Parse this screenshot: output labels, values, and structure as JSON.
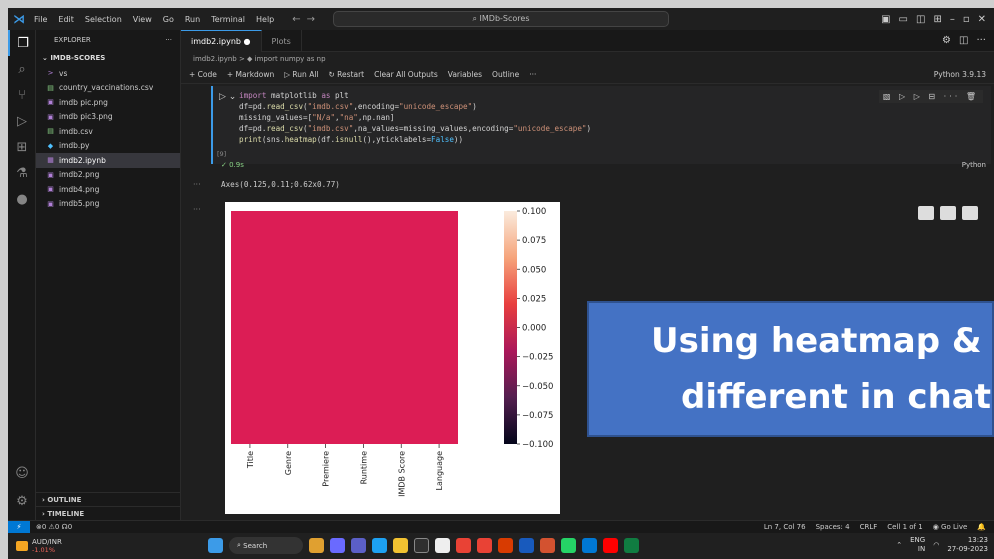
{
  "titlebar": {
    "menus": [
      "File",
      "Edit",
      "Selection",
      "View",
      "Go",
      "Run",
      "Terminal",
      "Help"
    ],
    "search": "IMDb-Scores"
  },
  "sidebar": {
    "header": "EXPLORER",
    "folder": "IMDB-SCORES",
    "items": [
      {
        "label": "vs",
        "icon": ">"
      },
      {
        "label": "country_vaccinations.csv",
        "icon": "▤"
      },
      {
        "label": "imdb pic.png",
        "icon": "▣"
      },
      {
        "label": "imdb pic3.png",
        "icon": "▣"
      },
      {
        "label": "imdb.csv",
        "icon": "▤"
      },
      {
        "label": "imdb.py",
        "icon": "◆"
      },
      {
        "label": "imdb2.ipynb",
        "icon": "▦"
      },
      {
        "label": "imdb2.png",
        "icon": "▣"
      },
      {
        "label": "imdb4.png",
        "icon": "▣"
      },
      {
        "label": "imdb5.png",
        "icon": "▣"
      }
    ],
    "outline": "OUTLINE",
    "timeline": "TIMELINE"
  },
  "tabs": [
    {
      "label": "imdb2.ipynb ●"
    },
    {
      "label": "Plots"
    }
  ],
  "breadcrumb": "imdb2.ipynb > ◆ import numpy as np",
  "toolbar": {
    "code": "+ Code",
    "markdown": "+ Markdown",
    "run_all": "▷ Run All",
    "restart": "↻ Restart",
    "clear": "Clear All Outputs",
    "variables": "Variables",
    "outline": "Outline",
    "more": "···",
    "kernel": "Python 3.9.13"
  },
  "cell": {
    "exec_count": "[9]",
    "status": "✓ 0.9s",
    "language": "Python",
    "output_text": "Axes(0.125,0.11;0.62x0.77)"
  },
  "chart_data": {
    "type": "heatmap",
    "categories": [
      "Title",
      "Genre",
      "Premiere",
      "Runtime",
      "IMDB Score",
      "Language"
    ],
    "values_all": 0.0,
    "cell_color": "#dc1d55",
    "colorbar_ticks": [
      "0.100",
      "0.075",
      "0.050",
      "0.025",
      "0.000",
      "−0.025",
      "−0.050",
      "−0.075",
      "−0.100"
    ],
    "colorbar_range": [
      -0.1,
      0.1
    ],
    "yticklabels": false
  },
  "statusbar": {
    "left": "⊗0 ⚠0  ☊0",
    "position": "Ln 7, Col 76",
    "spaces": "Spaces: 4",
    "eol": "CRLF",
    "cell": "Cell 1 of 1",
    "golive": "Go Live"
  },
  "taskbar": {
    "ticker_name": "AUD/INR",
    "ticker_change": "-1.01%",
    "search": "Search",
    "lang": "ENG",
    "region": "IN",
    "time": "13:23",
    "date": "27-09-2023"
  },
  "overlay": {
    "line1": "Using heatmap &",
    "line2": "different in chat"
  }
}
